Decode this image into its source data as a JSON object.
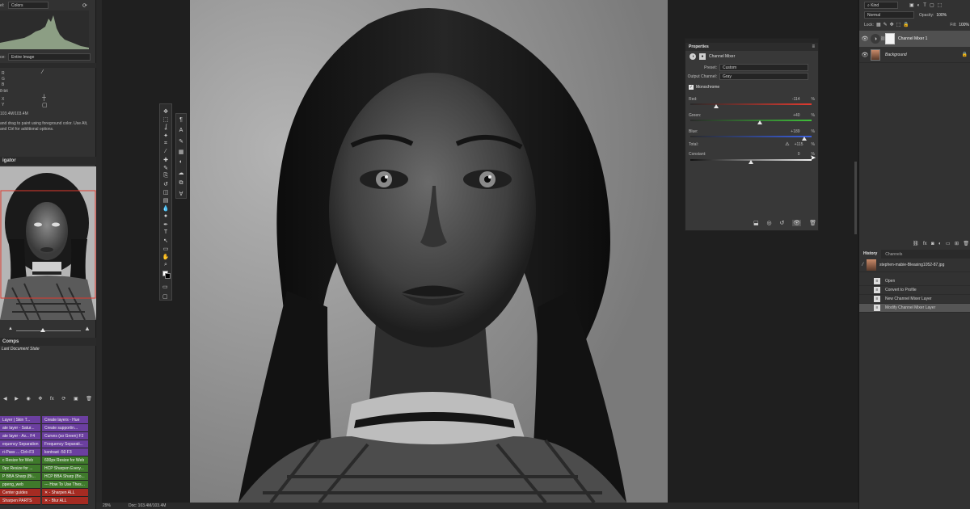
{
  "left": {
    "histogram": {
      "channel": "Colors",
      "source": "Entire Image"
    },
    "info": {
      "labels": [
        "R",
        "G",
        "B",
        "8-bit",
        "X",
        "Y"
      ],
      "doc_size": "103.4M/103.4M",
      "help_text": "and drag to paint using foreground color. Use Alt, and Ctrl for additional options."
    },
    "navigator": {
      "title": "igator"
    },
    "comps": {
      "title": "Comps",
      "item": "Last Document State"
    },
    "actions": [
      {
        "left": "Layer | Skin T...",
        "right": "Create layers - Hue",
        "color": "#6b3fa0"
      },
      {
        "left": "ate layer - Satur...",
        "right": "Create supportin...",
        "color": "#6b3fa0"
      },
      {
        "left": "ate layer - Av...   F4",
        "right": "Curves (so Green)   F2",
        "color": "#6b3fa0"
      },
      {
        "left": "equency Separation",
        "right": "Frequency Separati...",
        "color": "#6b3fa0"
      },
      {
        "left": "ri-Pass ...   Ctrl+F3",
        "right": "kontrast -50   F3",
        "color": "#6b3fa0"
      },
      {
        "left": "c Resize for Web",
        "right": "600px Resize for Web",
        "color": "#3f7a2b"
      },
      {
        "left": "0px Resize for ...",
        "right": "HCP Sharpen Every...",
        "color": "#3f7a2b"
      },
      {
        "left": "P BBA Sharp (Bi...",
        "right": "HCP BBA Sharp (Bo...",
        "color": "#3f7a2b"
      },
      {
        "left": "ppeng_web",
        "right": "--- How To Use Thes...",
        "color": "#3f7a2b"
      },
      {
        "left": "Center guides",
        "right": "✕ - Sharpen ALL",
        "color": "#a52b22"
      },
      {
        "left": "Sharpen PARTS",
        "right": "✕ - Blur ALL",
        "color": "#a52b22"
      }
    ]
  },
  "toolbar": {
    "tools": [
      "move-tool",
      "marquee-tool",
      "lasso-tool",
      "quick-select-tool",
      "crop-tool",
      "eyedropper-tool",
      "healing-tool",
      "brush-tool",
      "stamp-tool",
      "history-brush-tool",
      "eraser-tool",
      "gradient-tool",
      "blur-tool",
      "dodge-tool",
      "pen-tool",
      "type-tool",
      "path-select-tool",
      "shape-tool",
      "hand-tool",
      "zoom-tool",
      "more-tools"
    ],
    "side_icons": [
      "paragraph-icon",
      "character-icon",
      "brush-settings-icon",
      "swatches-icon",
      "adjustments-icon",
      "cc-libraries-icon",
      "properties-icon",
      "glyphs-icon"
    ]
  },
  "properties": {
    "tab": "Properties",
    "adjustment_name": "Channel Mixer",
    "preset_label": "Preset:",
    "preset_value": "Custom",
    "output_label": "Output Channel:",
    "output_value": "Gray",
    "monochrome_label": "Monochrome",
    "monochrome_checked": true,
    "channels": [
      {
        "name": "Red:",
        "value": "-114",
        "unit": "%",
        "position": 0.21,
        "color_from": "#2a2a2a",
        "color_to": "#e03a2f"
      },
      {
        "name": "Green:",
        "value": "+40",
        "unit": "%",
        "position": 0.57,
        "color_from": "#2a2a2a",
        "color_to": "#3fbf3a"
      },
      {
        "name": "Blue:",
        "value": "+189",
        "unit": "%",
        "position": 0.94,
        "color_from": "#2a2a2a",
        "color_to": "#3a5fe0"
      }
    ],
    "total_label": "Total:",
    "total_value": "+115",
    "total_unit": "%",
    "constant_label": "Constant:",
    "constant_value": "0",
    "constant_unit": "%",
    "constant_position": 0.5
  },
  "layers": {
    "kind_label": "Kind",
    "blend_mode": "Normal",
    "opacity_label": "Opacity:",
    "opacity_value": "100%",
    "lock_label": "Lock:",
    "fill_label": "Fill:",
    "fill_value": "100%",
    "items": [
      {
        "name": "Channel Mixer 1"
      },
      {
        "name": "Background"
      }
    ]
  },
  "history": {
    "tabs": [
      "History",
      "Channels"
    ],
    "snapshot": "stephen-mabie-Bleasing1052-87.jpg",
    "steps": [
      "Open",
      "Convert to Profile",
      "New Channel Mixer Layer",
      "Modify Channel Mixer Layer"
    ]
  },
  "status": {
    "zoom": "29%",
    "doc": "Doc: 103.4M/103.4M"
  }
}
